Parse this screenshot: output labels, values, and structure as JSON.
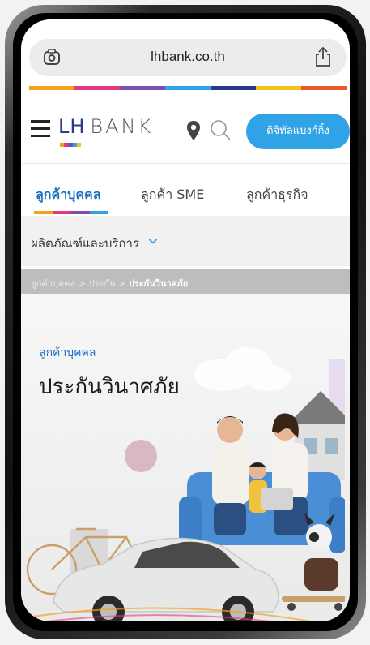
{
  "browser": {
    "url": "lhbank.co.th",
    "left_icon": "page-scan-icon",
    "right_icon": "share-icon"
  },
  "stripe_colors": [
    "#f4a21c",
    "#e23a7e",
    "#7b4fb0",
    "#2fa3e6",
    "#2b3a8f",
    "#f4c41c",
    "#e85a2a"
  ],
  "header": {
    "logo_lh": "LH",
    "logo_bank": "BANK",
    "digital_button": "ดิจิทัลแบงก์กิ้ง"
  },
  "tabs": [
    {
      "label": "ลูกค้าบุคคล",
      "active": true
    },
    {
      "label": "ลูกค้า SME",
      "active": false
    },
    {
      "label": "ลูกค้าธุรกิจ",
      "active": false
    }
  ],
  "products_menu": {
    "label": "ผลิตภัณฑ์และบริการ"
  },
  "breadcrumb": {
    "items": [
      "ลูกค้าบุคคล",
      "ประกัน"
    ],
    "separator": ">",
    "current": "ประกันวินาศภัย"
  },
  "hero": {
    "eyebrow": "ลูกค้าบุคคล",
    "title": "ประกันวินาศภัย"
  },
  "colors": {
    "accent": "#2fa3e6",
    "brand": "#2b3a8f",
    "tab_active": "#1e6fc0"
  }
}
